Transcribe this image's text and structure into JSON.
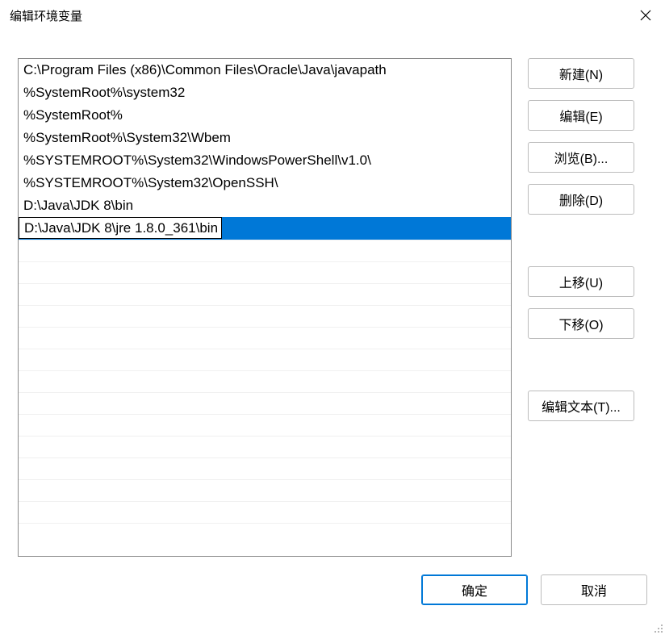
{
  "titlebar": {
    "title": "编辑环境变量"
  },
  "list": {
    "items": [
      "C:\\Program Files (x86)\\Common Files\\Oracle\\Java\\javapath",
      "%SystemRoot%\\system32",
      "%SystemRoot%",
      "%SystemRoot%\\System32\\Wbem",
      "%SYSTEMROOT%\\System32\\WindowsPowerShell\\v1.0\\",
      "%SYSTEMROOT%\\System32\\OpenSSH\\",
      "D:\\Java\\JDK 8\\bin",
      "D:\\Java\\JDK 8\\jre 1.8.0_361\\bin"
    ],
    "selected_index": 7
  },
  "buttons": {
    "new": "新建(N)",
    "edit": "编辑(E)",
    "browse": "浏览(B)...",
    "delete": "删除(D)",
    "move_up": "上移(U)",
    "move_down": "下移(O)",
    "edit_text": "编辑文本(T)...",
    "ok": "确定",
    "cancel": "取消"
  }
}
